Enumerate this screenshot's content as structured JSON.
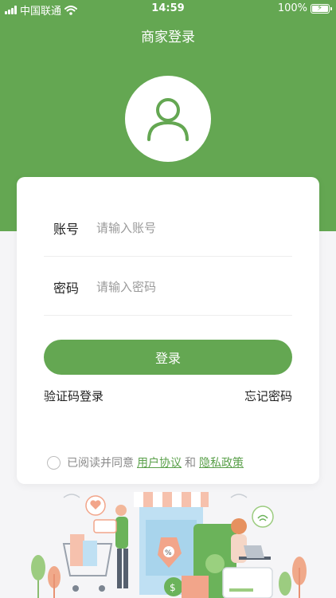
{
  "status_bar": {
    "carrier": "中国联通",
    "time": "14:59",
    "battery": "100%"
  },
  "header": {
    "title": "商家登录"
  },
  "form": {
    "account_label": "账号",
    "account_placeholder": "请输入账号",
    "password_label": "密码",
    "password_placeholder": "请输入密码"
  },
  "actions": {
    "login_label": "登录",
    "sms_login_label": "验证码登录",
    "forgot_label": "忘记密码"
  },
  "agreement": {
    "prefix": "已阅读并同意",
    "user_agreement": "用户协议",
    "and": "和",
    "privacy_policy": "隐私政策"
  },
  "colors": {
    "brand_green": "#64a752",
    "background": "#f5f5f7"
  },
  "icons": {
    "avatar": "user-icon",
    "wifi": "wifi-icon",
    "battery": "battery-charging-icon"
  }
}
